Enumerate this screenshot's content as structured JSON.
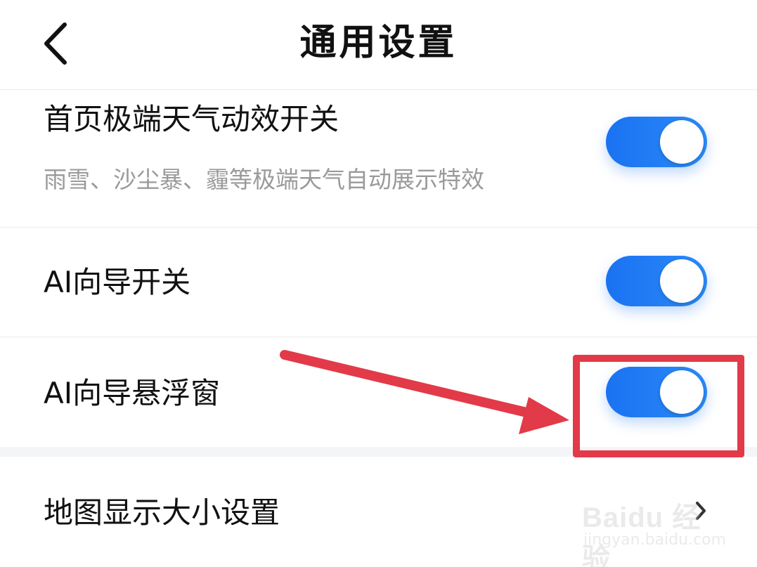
{
  "header": {
    "title": "通用设置",
    "back_icon": "chevron-left-icon"
  },
  "settings": {
    "extreme_weather": {
      "label": "首页极端天气动效开关",
      "description": "雨雪、沙尘暴、霾等极端天气自动展示特效",
      "enabled": true
    },
    "ai_guide": {
      "label": "AI向导开关",
      "enabled": true
    },
    "ai_float": {
      "label": "AI向导悬浮窗",
      "enabled": true
    },
    "map_size": {
      "label": "地图显示大小设置",
      "chevron_icon": "chevron-right-icon"
    }
  },
  "annotation": {
    "color": "#e23a48"
  },
  "watermark": {
    "brand": "Baidu 经验",
    "url": "jingyan.baidu.com"
  },
  "colors": {
    "switch_on": "#1a72f2",
    "text_primary": "#111111",
    "text_secondary": "#9a9a9a"
  }
}
